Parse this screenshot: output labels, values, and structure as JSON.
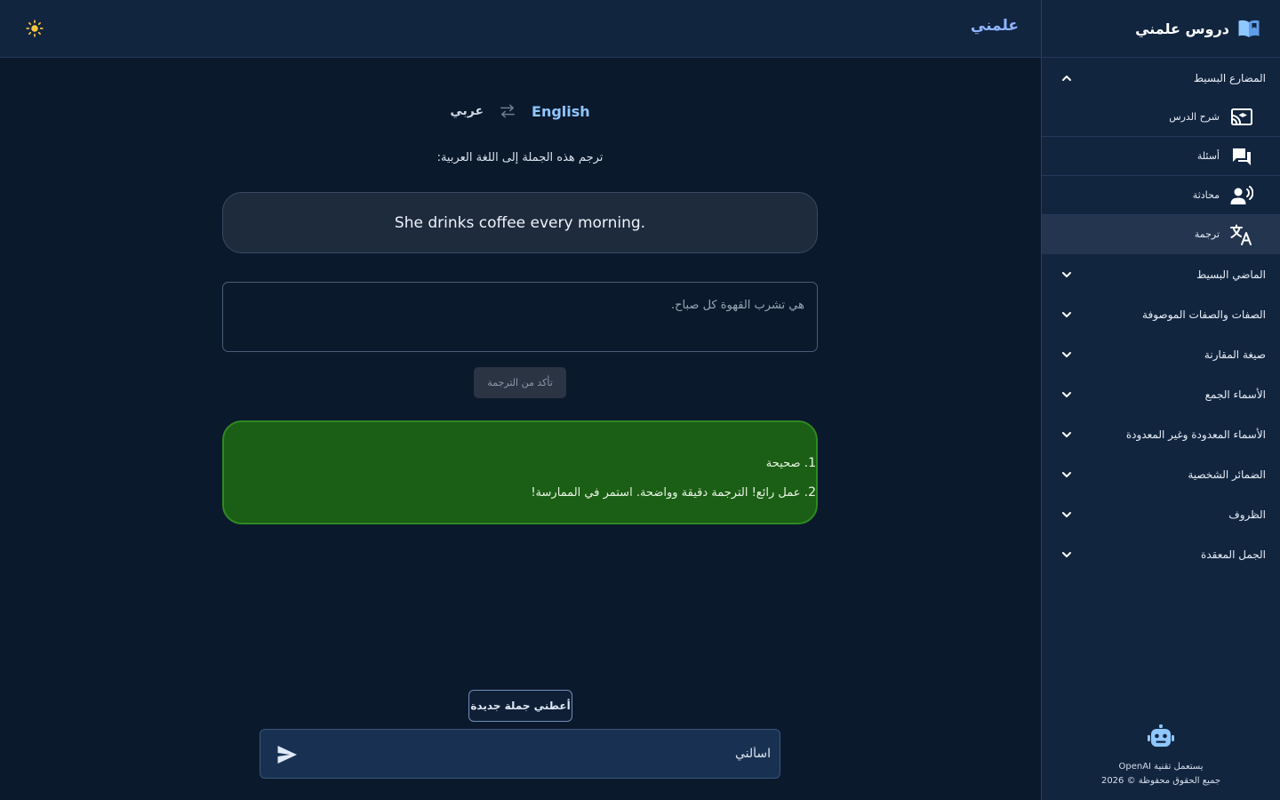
{
  "app": {
    "brand": "علمني",
    "sidebar_title": "دروس علمني"
  },
  "colors": {
    "background": "#0b192c",
    "panel": "#12253f",
    "accent": "#8fc7ff",
    "success": "#1b5e15",
    "sun": "#f5c542"
  },
  "sidebar": {
    "sections": [
      {
        "label": "المضارع البسيط",
        "expanded": true,
        "items": [
          {
            "label": "شرح الدرس",
            "icon": "cast-for-education-icon"
          },
          {
            "label": "أسئلة",
            "icon": "chat-bubbles-icon"
          },
          {
            "label": "محادثة",
            "icon": "record-voice-icon"
          },
          {
            "label": "ترجمة",
            "icon": "translate-icon",
            "active": true
          }
        ]
      },
      {
        "label": "الماضي البسيط",
        "expanded": false
      },
      {
        "label": "الصفات والصفات الموصوفة",
        "expanded": false
      },
      {
        "label": "صيغة المقارنة",
        "expanded": false
      },
      {
        "label": "الأسماء الجمع",
        "expanded": false
      },
      {
        "label": "الأسماء المعدودة وغير المعدودة",
        "expanded": false
      },
      {
        "label": "الضمائر الشخصية",
        "expanded": false
      },
      {
        "label": "الظروف",
        "expanded": false
      },
      {
        "label": "الجمل المعقدة",
        "expanded": false
      }
    ],
    "footer": {
      "icon": "robot-icon",
      "powered_by": "يستعمل تقنية OpenAI",
      "copyright": "جميع الحقوق محفوظة © 2026"
    }
  },
  "translation": {
    "source_lang": "English",
    "target_lang": "عربي",
    "instruction": "ترجم هذه الجملة إلى اللغة العربية:",
    "sentence": "She drinks coffee every morning.",
    "answer": "هي تشرب القهوة كل صباح.",
    "check_button": "تأكد من الترجمة",
    "feedback": [
      {
        "num": "1.",
        "text": "صحيحة"
      },
      {
        "num": "2.",
        "text": "عمل رائع! الترجمة دقيقة وواضحة. استمر في الممارسة!"
      }
    ],
    "new_sentence_button": "أعطني جملة جديدة"
  },
  "chat": {
    "placeholder": "اسألني"
  }
}
